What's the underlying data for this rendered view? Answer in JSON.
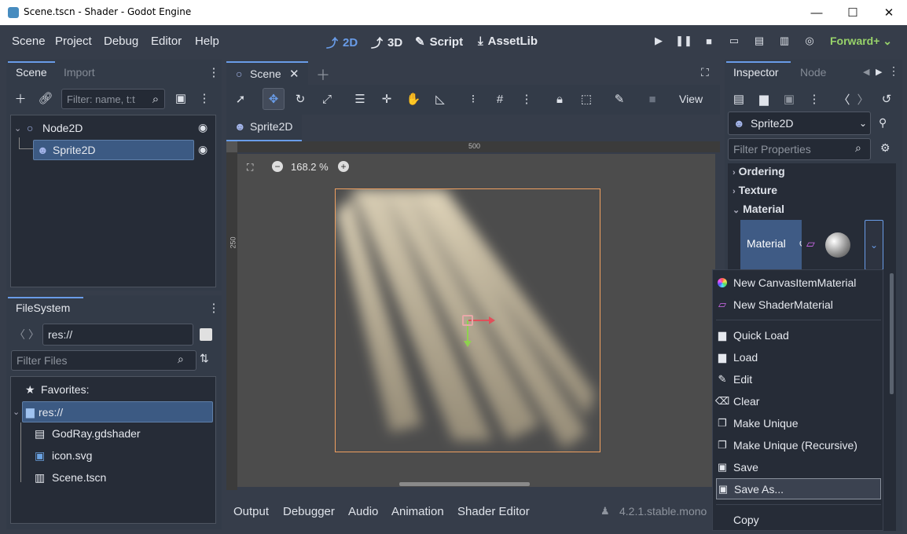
{
  "window": {
    "title": "Scene.tscn - Shader - Godot Engine",
    "minimize": "—",
    "maximize": "☐",
    "close": "✕"
  },
  "menu": {
    "items": [
      "Scene",
      "Project",
      "Debug",
      "Editor",
      "Help"
    ]
  },
  "modes": {
    "m2d": "2D",
    "m3d": "3D",
    "script": "Script",
    "assetlib": "AssetLib"
  },
  "renderer": "Forward+ ⌄",
  "scene_dock": {
    "tab_scene": "Scene",
    "tab_import": "Import",
    "filter_placeholder": "Filter: name, t:t",
    "nodes": [
      {
        "label": "Node2D"
      },
      {
        "label": "Sprite2D"
      }
    ]
  },
  "filesystem": {
    "title": "FileSystem",
    "path": "res://",
    "filter_placeholder": "Filter Files",
    "favorites": "Favorites:",
    "root": "res://",
    "files": [
      "GodRay.gdshader",
      "icon.svg",
      "Scene.tscn"
    ]
  },
  "editor": {
    "tab_scene": "Scene",
    "file_tab": "Sprite2D",
    "view": "View",
    "zoom": "168.2 %",
    "ruler_500": "500",
    "ruler_250": "250"
  },
  "inspector": {
    "tab_inspector": "Inspector",
    "tab_node": "Node",
    "object": "Sprite2D",
    "filter_placeholder": "Filter Properties",
    "sections": [
      "Ordering",
      "Texture",
      "Material"
    ],
    "material_label": "Material"
  },
  "context_menu": {
    "items": [
      "New CanvasItemMaterial",
      "New ShaderMaterial",
      "Quick Load",
      "Load",
      "Edit",
      "Clear",
      "Make Unique",
      "Make Unique (Recursive)",
      "Save",
      "Save As...",
      "Copy"
    ]
  },
  "bottom": {
    "tabs": [
      "Output",
      "Debugger",
      "Audio",
      "Animation",
      "Shader Editor"
    ],
    "version": "4.2.1.stable.mono"
  },
  "colors": {
    "accent": "#699ce8",
    "renderer": "#98d36a",
    "selection": "#3c5a83",
    "x_axis": "#e0505a",
    "y_axis": "#8fd14f",
    "sprite_outline": "#f0a060"
  }
}
